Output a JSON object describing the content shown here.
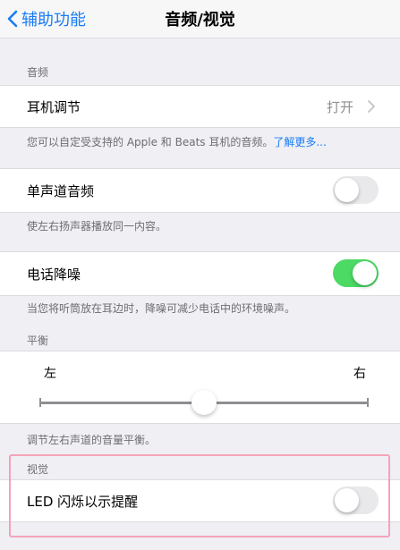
{
  "nav": {
    "back_label": "辅助功能",
    "title": "音频/视觉"
  },
  "audio": {
    "section_label": "音频",
    "headphone": {
      "label": "耳机调节",
      "value": "打开"
    },
    "headphone_footer_text": "您可以自定受支持的 Apple 和 Beats 耳机的音频。",
    "headphone_footer_link": "了解更多..."
  },
  "mono": {
    "label": "单声道音频",
    "enabled": false,
    "footer": "使左右扬声器播放同一内容。"
  },
  "noise": {
    "label": "电话降噪",
    "enabled": true,
    "footer": "当您将听筒放在耳边时，降噪可减少电话中的环境噪声。"
  },
  "balance": {
    "section_label": "平衡",
    "left": "左",
    "right": "右",
    "value": 0.5,
    "footer": "调节左右声道的音量平衡。"
  },
  "visual": {
    "section_label": "视觉",
    "led": {
      "label": "LED 闪烁以示提醒",
      "enabled": false
    }
  },
  "colors": {
    "accent": "#1a7cf5",
    "toggle_on": "#4cd964",
    "toggle_off": "#e9e9eb",
    "highlight": "#f5a3b8"
  }
}
